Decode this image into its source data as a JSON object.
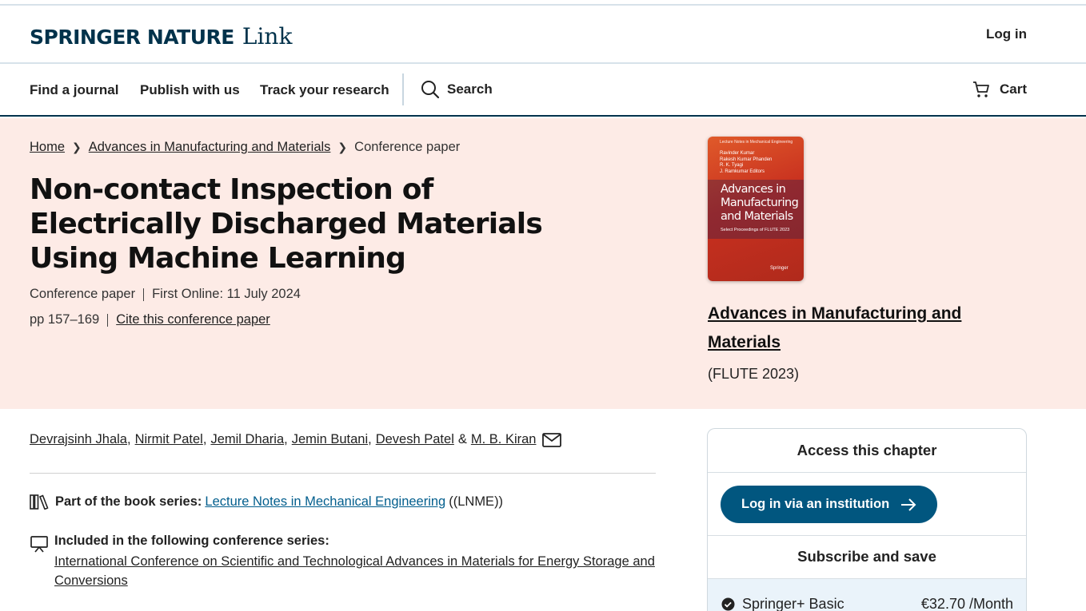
{
  "header": {
    "brand": "SPRINGER NATURE",
    "brand_suffix": "Link",
    "login": "Log in"
  },
  "nav": {
    "items": [
      "Find a journal",
      "Publish with us",
      "Track your research"
    ],
    "search": "Search",
    "cart": "Cart"
  },
  "breadcrumb": {
    "home": "Home",
    "book": "Advances in Manufacturing and Materials",
    "current": "Conference paper"
  },
  "article": {
    "title": "Non-contact Inspection of Electrically Discharged Materials Using Machine Learning",
    "type": "Conference paper",
    "first_online": "First Online: 11 July 2024",
    "pages": "pp 157–169",
    "cite": "Cite this conference paper"
  },
  "book": {
    "cover_series": "Lecture Notes in Mechanical Engineering",
    "cover_editors": [
      "Ravinder Kumar",
      "Rakesh Kumar Phanden",
      "R. K. Tyagi",
      "J. Ramkumar  Editors"
    ],
    "cover_title": "Advances in Manufacturing and Materials",
    "cover_subtitle": "Select Proceedings of FLUTE 2023",
    "cover_publisher": "Springer",
    "title": "Advances in Manufacturing and Materials",
    "subtitle": "(FLUTE 2023)"
  },
  "authors": [
    "Devrajsinh Jhala",
    "Nirmit Patel",
    "Jemil Dharia",
    "Jemin Butani",
    "Devesh Patel",
    "M. B. Kiran"
  ],
  "series": {
    "label": "Part of the book series:",
    "name": "Lecture Notes in Mechanical Engineering",
    "abbr": "((LNME))"
  },
  "conference": {
    "label": "Included in the following conference series:",
    "name": "International Conference on Scientific and Technological Advances in Materials for Energy Storage and Conversions"
  },
  "access": {
    "title": "Access this chapter",
    "institution_button": "Log in via an institution",
    "subscribe_title": "Subscribe and save",
    "plan_name": "Springer+ Basic",
    "plan_price": "€32.70 /Month"
  },
  "colors": {
    "brand": "#01324b",
    "hero_bg": "#fdebe6",
    "link_blue": "#025e8d",
    "button_blue": "#01567f"
  }
}
